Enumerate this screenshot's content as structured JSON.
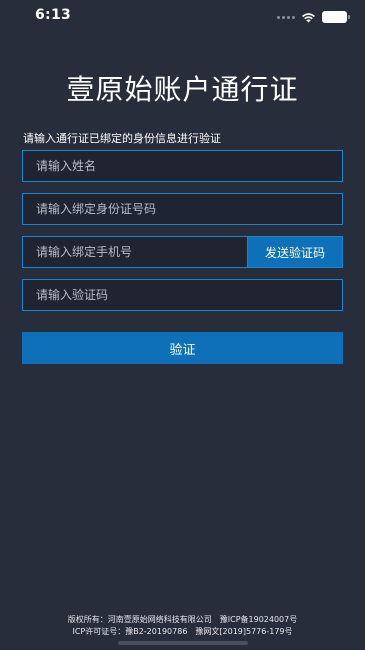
{
  "status_bar": {
    "time": "6:13"
  },
  "title": "壹原始账户通行证",
  "instruction": "请输入通行证已绑定的身份信息进行验证",
  "form": {
    "name_placeholder": "请输入姓名",
    "id_placeholder": "请输入绑定身份证号码",
    "phone_placeholder": "请输入绑定手机号",
    "send_code_label": "发送验证码",
    "code_placeholder": "请输入验证码",
    "verify_label": "验证"
  },
  "footer": {
    "copyright": "版权所有：河南壹原始网络科技有限公司",
    "icp_record": "豫ICP备19024007号",
    "icp_license": "ICP许可证号：豫B2-20190786",
    "culture_license": "豫网文[2019]5776-179号"
  },
  "colors": {
    "background": "#282d3c",
    "accent": "#0e70b8",
    "field_border": "#1686d3"
  }
}
